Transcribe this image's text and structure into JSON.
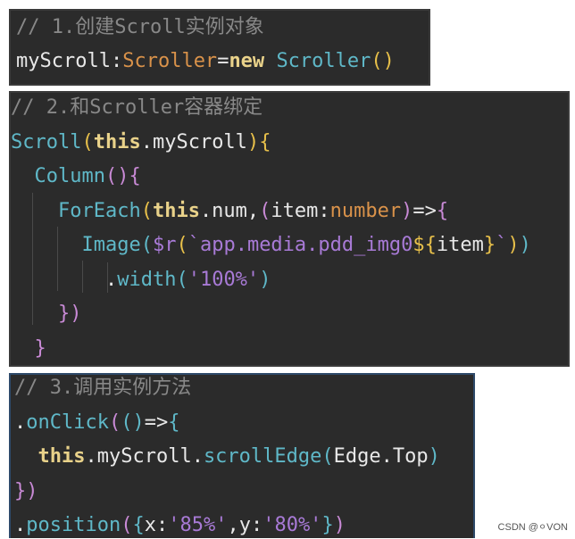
{
  "panels": [
    {
      "lines": [
        [
          {
            "t": "// 1.创建Scroll实例对象",
            "c": "comment"
          }
        ],
        [
          {
            "t": "myScroll",
            "c": "plain"
          },
          {
            "t": ":",
            "c": "plain"
          },
          {
            "t": "Scroller",
            "c": "type"
          },
          {
            "t": "=",
            "c": "plain"
          },
          {
            "t": "new",
            "c": "kw"
          },
          {
            "t": " ",
            "c": "plain"
          },
          {
            "t": "Scroller",
            "c": "fn"
          },
          {
            "t": "()",
            "c": "paren"
          }
        ]
      ]
    },
    {
      "lines": [
        [
          {
            "t": "// 2.和Scroller容器绑定",
            "c": "comment"
          }
        ],
        [
          {
            "t": "Scroll",
            "c": "fn"
          },
          {
            "t": "(",
            "c": "paren"
          },
          {
            "t": "this",
            "c": "kw"
          },
          {
            "t": ".myScroll",
            "c": "plain"
          },
          {
            "t": ")",
            "c": "paren"
          },
          {
            "t": "{",
            "c": "paren"
          }
        ],
        [
          {
            "t": "  ",
            "c": "plain"
          },
          {
            "t": "Column",
            "c": "fn"
          },
          {
            "t": "()",
            "c": "paren2"
          },
          {
            "t": "{",
            "c": "paren2"
          }
        ],
        [
          {
            "t": "    ",
            "c": "plain"
          },
          {
            "t": "ForEach",
            "c": "fn"
          },
          {
            "t": "(",
            "c": "paren"
          },
          {
            "t": "this",
            "c": "kw"
          },
          {
            "t": ".num,",
            "c": "plain"
          },
          {
            "t": "(",
            "c": "paren2"
          },
          {
            "t": "item",
            "c": "plain"
          },
          {
            "t": ":",
            "c": "plain"
          },
          {
            "t": "number",
            "c": "type"
          },
          {
            "t": ")",
            "c": "paren2"
          },
          {
            "t": "=>",
            "c": "plain"
          },
          {
            "t": "{",
            "c": "paren2"
          }
        ],
        [
          {
            "t": "      ",
            "c": "plain"
          },
          {
            "t": "Image",
            "c": "fn"
          },
          {
            "t": "(",
            "c": "paren3"
          },
          {
            "t": "$r",
            "c": "str"
          },
          {
            "t": "(",
            "c": "paren"
          },
          {
            "t": "`app.media.pdd_img0",
            "c": "str"
          },
          {
            "t": "${",
            "c": "paren"
          },
          {
            "t": "item",
            "c": "plain"
          },
          {
            "t": "}",
            "c": "paren"
          },
          {
            "t": "`",
            "c": "str"
          },
          {
            "t": ")",
            "c": "paren"
          },
          {
            "t": ")",
            "c": "paren3"
          }
        ],
        [
          {
            "t": "        ",
            "c": "plain"
          },
          {
            "t": ".",
            "c": "plain"
          },
          {
            "t": "width",
            "c": "fn"
          },
          {
            "t": "(",
            "c": "paren3"
          },
          {
            "t": "'100%'",
            "c": "str"
          },
          {
            "t": ")",
            "c": "paren3"
          }
        ],
        [
          {
            "t": "    ",
            "c": "plain"
          },
          {
            "t": "})",
            "c": "paren2"
          }
        ],
        [
          {
            "t": "  ",
            "c": "plain"
          },
          {
            "t": "}",
            "c": "paren2"
          }
        ]
      ]
    },
    {
      "lines": [
        [
          {
            "t": "// 3.调用实例方法",
            "c": "comment"
          }
        ],
        [
          {
            "t": ".",
            "c": "plain"
          },
          {
            "t": "onClick",
            "c": "fn"
          },
          {
            "t": "(",
            "c": "paren2"
          },
          {
            "t": "()",
            "c": "paren3"
          },
          {
            "t": "=>",
            "c": "plain"
          },
          {
            "t": "{",
            "c": "paren3"
          }
        ],
        [
          {
            "t": "  ",
            "c": "plain"
          },
          {
            "t": "this",
            "c": "kw"
          },
          {
            "t": ".myScroll.",
            "c": "plain"
          },
          {
            "t": "scrollEdge",
            "c": "fn"
          },
          {
            "t": "(",
            "c": "paren3"
          },
          {
            "t": "Edge.Top",
            "c": "plain"
          },
          {
            "t": ")",
            "c": "paren3"
          }
        ],
        [
          {
            "t": "})",
            "c": "paren2"
          }
        ],
        [
          {
            "t": ".",
            "c": "plain"
          },
          {
            "t": "position",
            "c": "fn"
          },
          {
            "t": "(",
            "c": "paren2"
          },
          {
            "t": "{",
            "c": "paren3"
          },
          {
            "t": "x",
            "c": "plain"
          },
          {
            "t": ":",
            "c": "plain"
          },
          {
            "t": "'85%'",
            "c": "str"
          },
          {
            "t": ",",
            "c": "plain"
          },
          {
            "t": "y",
            "c": "plain"
          },
          {
            "t": ":",
            "c": "plain"
          },
          {
            "t": "'80%'",
            "c": "str"
          },
          {
            "t": "}",
            "c": "paren3"
          },
          {
            "t": ")",
            "c": "paren2"
          }
        ]
      ]
    }
  ],
  "watermark": "CSDN @⚪VON"
}
